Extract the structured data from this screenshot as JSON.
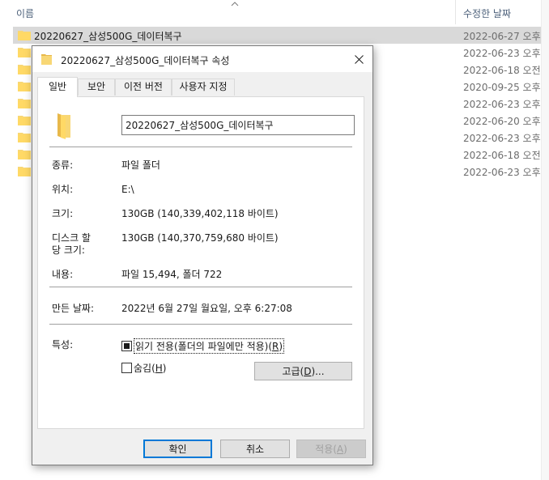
{
  "explorer": {
    "col_name": "이름",
    "col_date": "수정한 날짜",
    "rows": [
      {
        "name": "20220627_삼성500G_데이터복구",
        "date": "2022-06-27 오후"
      },
      {
        "name": "",
        "date": "2022-06-23 오후"
      },
      {
        "name": "",
        "date": "2022-06-18 오전"
      },
      {
        "name": "",
        "date": "2020-09-25 오후"
      },
      {
        "name": "",
        "date": "2022-06-23 오후"
      },
      {
        "name": "",
        "date": "2022-06-20 오후"
      },
      {
        "name": "",
        "date": "2022-06-23 오후"
      },
      {
        "name": "",
        "date": "2022-06-18 오전"
      },
      {
        "name": "",
        "date": "2022-06-23 오후"
      }
    ]
  },
  "dialog": {
    "title": "20220627_삼성500G_데이터복구 속성",
    "tabs": [
      "일반",
      "보안",
      "이전 버전",
      "사용자 지정"
    ],
    "folder_name": "20220627_삼성500G_데이터복구",
    "type_label": "종류:",
    "type_value": "파일 폴더",
    "location_label": "위치:",
    "location_value": "E:\\",
    "size_label": "크기:",
    "size_value": "130GB (140,339,402,118 바이트)",
    "disk_size_label_1": "디스크 할",
    "disk_size_label_2": "당 크기:",
    "disk_size_value": "130GB (140,370,759,680 바이트)",
    "contains_label": "내용:",
    "contains_value": "파일 15,494, 폴더 722",
    "created_label": "만든 날짜:",
    "created_value": "2022년 6월 27일 월요일, 오후 6:27:08",
    "attributes_label": "특성:",
    "readonly_text": "읽기 전용(폴더의 파일에만 적용)(",
    "readonly_key": "R",
    "readonly_close": ")",
    "hidden_text": "숨김(",
    "hidden_key": "H",
    "hidden_close": ")",
    "advanced_text": "고급(",
    "advanced_key": "D",
    "advanced_close": ")...",
    "ok": "확인",
    "cancel": "취소",
    "apply_text": "적용(",
    "apply_key": "A",
    "apply_close": ")",
    "colors": {
      "accent": "#0078d7",
      "folder": "#f8d775",
      "folder_dark": "#e8b84a"
    }
  }
}
